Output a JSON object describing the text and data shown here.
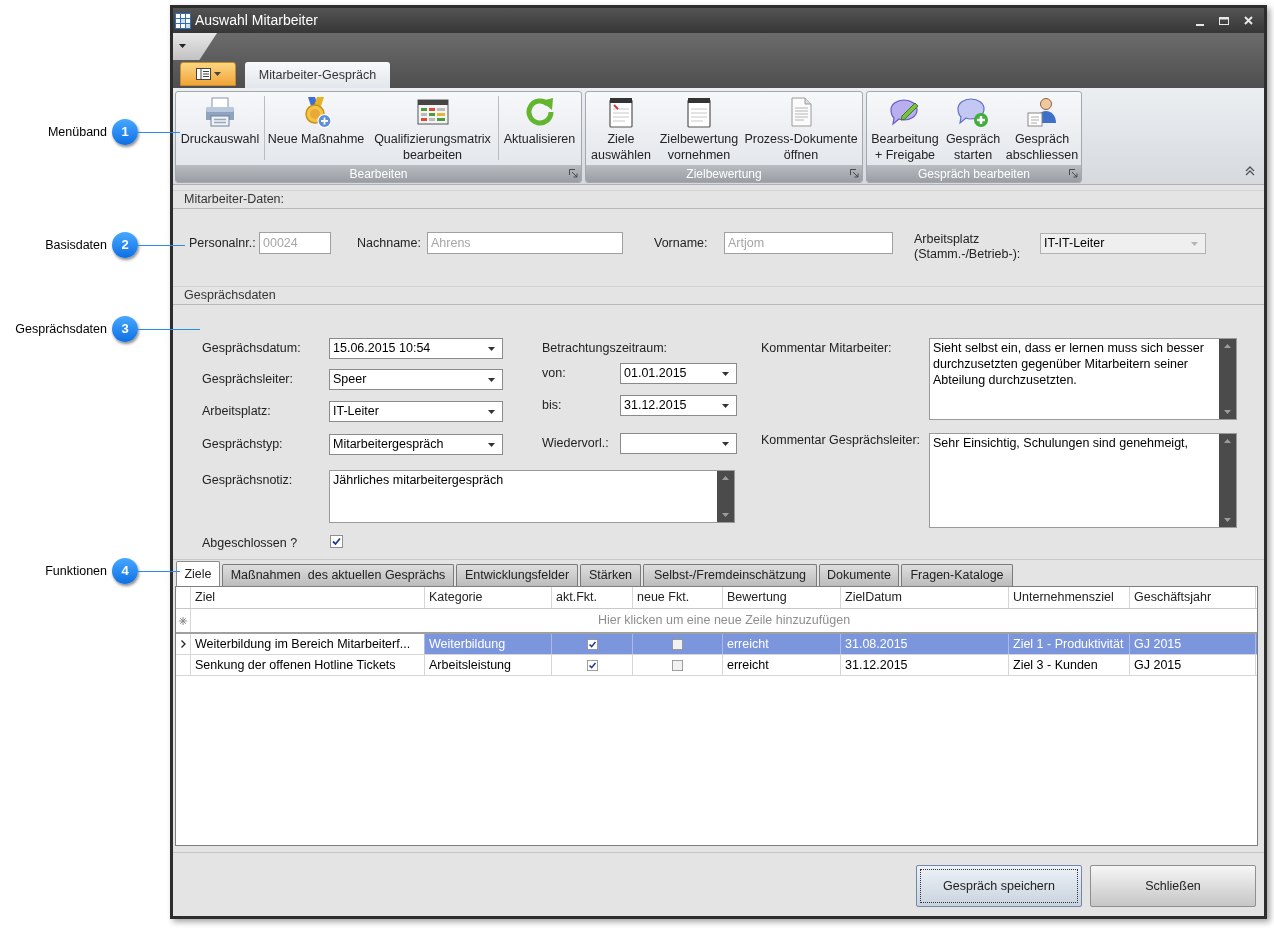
{
  "callouts": [
    {
      "number": "1",
      "label": "Menüband"
    },
    {
      "number": "2",
      "label": "Basisdaten"
    },
    {
      "number": "3",
      "label": "Gesprächsdaten"
    },
    {
      "number": "4",
      "label": "Funktionen"
    }
  ],
  "window": {
    "title": "Auswahl Mitarbeiter"
  },
  "ribbon": {
    "tabs": [
      {
        "label": "Mitarbeiter-Gespräch",
        "selected": true
      }
    ],
    "groups": [
      {
        "caption": "Bearbeiten",
        "sections": [
          {
            "buttons": [
              {
                "label": "Druckauswahl"
              }
            ]
          },
          {
            "buttons": [
              {
                "label": "Neue Maßnahme"
              },
              {
                "label": "Qualifizierungsmatrix\nbearbeiten"
              }
            ]
          },
          {
            "buttons": [
              {
                "label": "Aktualisieren"
              }
            ]
          }
        ]
      },
      {
        "caption": "Zielbewertung",
        "sections": [
          {
            "buttons": [
              {
                "label": "Ziele\nauswählen"
              },
              {
                "label": "Zielbewertung\nvornehmen"
              },
              {
                "label": "Prozess-Dokumente\nöffnen"
              }
            ]
          }
        ]
      },
      {
        "caption": "Gespräch bearbeiten",
        "sections": [
          {
            "buttons": [
              {
                "label": "Bearbeitung\n+ Freigabe"
              },
              {
                "label": "Gespräch\nstarten"
              },
              {
                "label": "Gespräch\nabschliessen"
              }
            ]
          }
        ]
      }
    ]
  },
  "employee": {
    "header": "Mitarbeiter-Daten:",
    "fields": [
      {
        "kind": "text",
        "label": "Personalnr.:",
        "value": "00024",
        "disabled": true
      },
      {
        "kind": "text",
        "label": "Nachname:",
        "value": "Ahrens",
        "disabled": true
      },
      {
        "kind": "text",
        "label": "Vorname:",
        "value": "Artjom",
        "disabled": true
      },
      {
        "kind": "combo",
        "label": "Arbeitsplatz\n(Stamm.-/Betrieb-):",
        "value": "IT-IT-Leiter",
        "disabled": true
      }
    ]
  },
  "conversation": {
    "header": "Gesprächsdaten",
    "fields": [
      {
        "label": "Gesprächsdatum:",
        "value": "15.06.2015 10:54"
      },
      {
        "label": "Gesprächsleiter:",
        "value": "Speer"
      },
      {
        "label": "Arbeitsplatz:",
        "value": "IT-Leiter"
      },
      {
        "label": "Gesprächstyp:",
        "value": "Mitarbeitergespräch"
      }
    ],
    "period": {
      "label": "Betrachtungszeitraum:",
      "fields": [
        {
          "label": "von:",
          "value": "01.01.2015"
        },
        {
          "label": "bis:",
          "value": "31.12.2015"
        }
      ]
    },
    "resubmission": {
      "label": "Wiedervorl.:"
    },
    "note": {
      "label": "Gesprächsnotiz:",
      "value": "Jährliches mitarbeitergespräch"
    },
    "closed": {
      "label": "Abgeschlossen ?",
      "checked": true
    },
    "comments": [
      {
        "label": "Kommentar Mitarbeiter:",
        "value": "Sieht selbst ein, dass er lernen muss sich besser durchzusetzten gegenüber Mitarbeitern seiner Abteilung durchzusetzten."
      },
      {
        "label": "Kommentar Gesprächsleiter:",
        "value": "Sehr Einsichtig, Schulungen sind genehmeigt,"
      }
    ]
  },
  "function_tabs": [
    {
      "label": "Ziele",
      "selected": true
    },
    {
      "label": "Maßnahmen  des aktuellen Gesprächs",
      "selected": false
    },
    {
      "label": "Entwicklungsfelder",
      "selected": false
    },
    {
      "label": "Stärken",
      "selected": false
    },
    {
      "label": "Selbst-/Fremdeinschätzung",
      "selected": false
    },
    {
      "label": "Dokumente",
      "selected": false
    },
    {
      "label": "Fragen-Kataloge",
      "selected": false
    }
  ],
  "grid": {
    "columns": [
      "Ziel",
      "Kategorie",
      "akt.Fkt.",
      "neue Fkt.",
      "Bewertung",
      "ZielDatum",
      "Unternehmensziel",
      "Geschäftsjahr"
    ],
    "new_row_hint": "Hier klicken um eine neue Zeile hinzuzufügen",
    "rows": [
      {
        "selected": true,
        "ziel": "Weiterbildung im Bereich Mitarbeiterf...",
        "kategorie": "Weiterbildung",
        "akt_fkt": true,
        "neue_fkt": false,
        "bewertung": "erreicht",
        "zieldatum": "31.08.2015",
        "unternehmensziel": "Ziel 1 - Produktivität",
        "geschaeftsjahr": "GJ 2015"
      },
      {
        "selected": false,
        "ziel": "Senkung der offenen Hotline Tickets",
        "kategorie": "Arbeitsleistung",
        "akt_fkt": true,
        "neue_fkt": false,
        "bewertung": "erreicht",
        "zieldatum": "31.12.2015",
        "unternehmensziel": "Ziel 3 - Kunden",
        "geschaeftsjahr": "GJ 2015"
      }
    ]
  },
  "buttons": [
    {
      "label": "Gespräch speichern",
      "focused": true
    },
    {
      "label": "Schließen",
      "focused": false
    }
  ]
}
